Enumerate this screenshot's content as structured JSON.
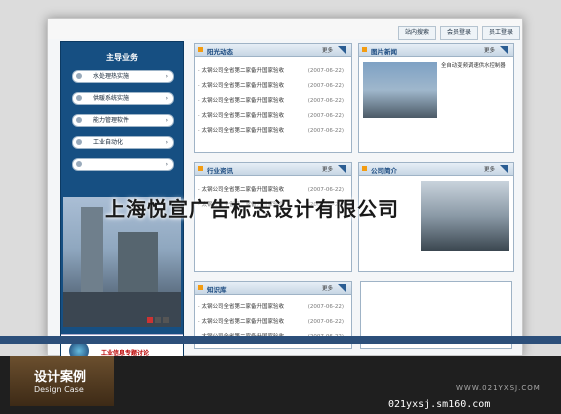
{
  "topbar": {
    "buttons": [
      "站内搜索",
      "会员登录",
      "员工登录"
    ]
  },
  "sidebar": {
    "title": "主导业务",
    "items": [
      {
        "label": "水处理热实施"
      },
      {
        "label": "供暖系统实施"
      },
      {
        "label": "能力管理软件"
      },
      {
        "label": "工业自动化"
      },
      {
        "label": ""
      }
    ],
    "promo": "工业信息专题讨论"
  },
  "panels": {
    "industry_news": {
      "title": "阳光动态",
      "more": "更多"
    },
    "photo_news": {
      "title": "图片新闻",
      "more": "更多"
    },
    "trade_info": {
      "title": "行业资讯",
      "more": "更多"
    },
    "company": {
      "title": "公司简介",
      "more": "更多"
    },
    "knowledge": {
      "title": "知识库",
      "more": "更多"
    }
  },
  "news": {
    "text": "太钢公司全省第二家备升国家验收",
    "dates": [
      "(2007-06-22)",
      "(2007-06-22)",
      "(2007-06-22)",
      "(2007-06-22)",
      "(2007-06-22)"
    ]
  },
  "photo_text": "全自动变频调速供水控制器",
  "overlay_text": "上海悦宣广告标志设计有限公司",
  "bottom": {
    "title": "设计案例",
    "subtitle": "Design Case",
    "url": "WWW.021YXSJ.COM",
    "domain": "021yxsj.sm160.com"
  },
  "colors": {
    "accent": "#164f82",
    "panel_title": "#1a4a80",
    "promo_red": "#b00000"
  }
}
